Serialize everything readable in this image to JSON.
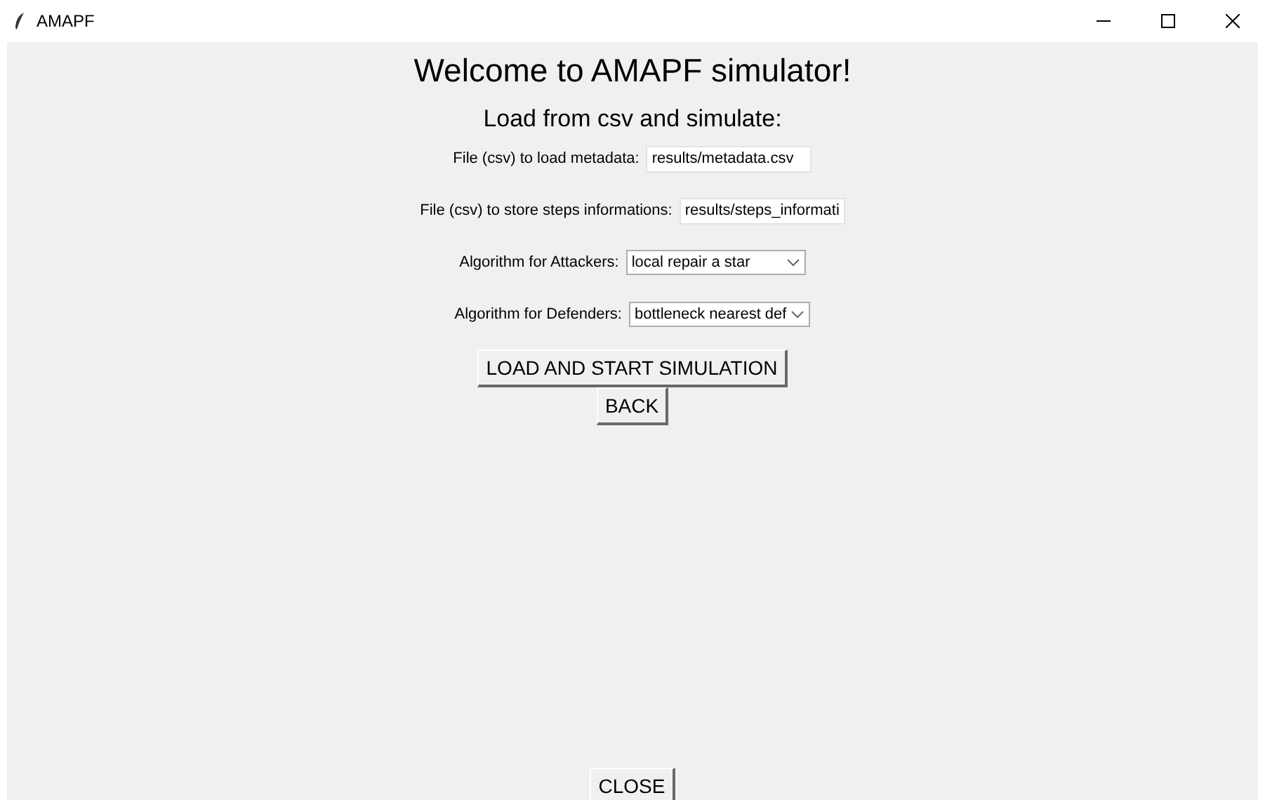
{
  "window": {
    "title": "AMAPF"
  },
  "heading": "Welcome to AMAPF simulator!",
  "subheading": "Load from csv and simulate:",
  "fields": [
    {
      "kind": "entry",
      "label": "File (csv) to load metadata:",
      "value": "results/metadata.csv"
    },
    {
      "kind": "entry",
      "label": "File (csv) to store steps informations:",
      "value": "results/steps_informati"
    },
    {
      "kind": "select",
      "label": "Algorithm for Attackers:",
      "value": "local repair a star"
    },
    {
      "kind": "select",
      "label": "Algorithm for Defenders:",
      "value": "bottleneck nearest def"
    }
  ],
  "buttons": [
    "LOAD AND START SIMULATION",
    "BACK"
  ],
  "close_button": "CLOSE"
}
